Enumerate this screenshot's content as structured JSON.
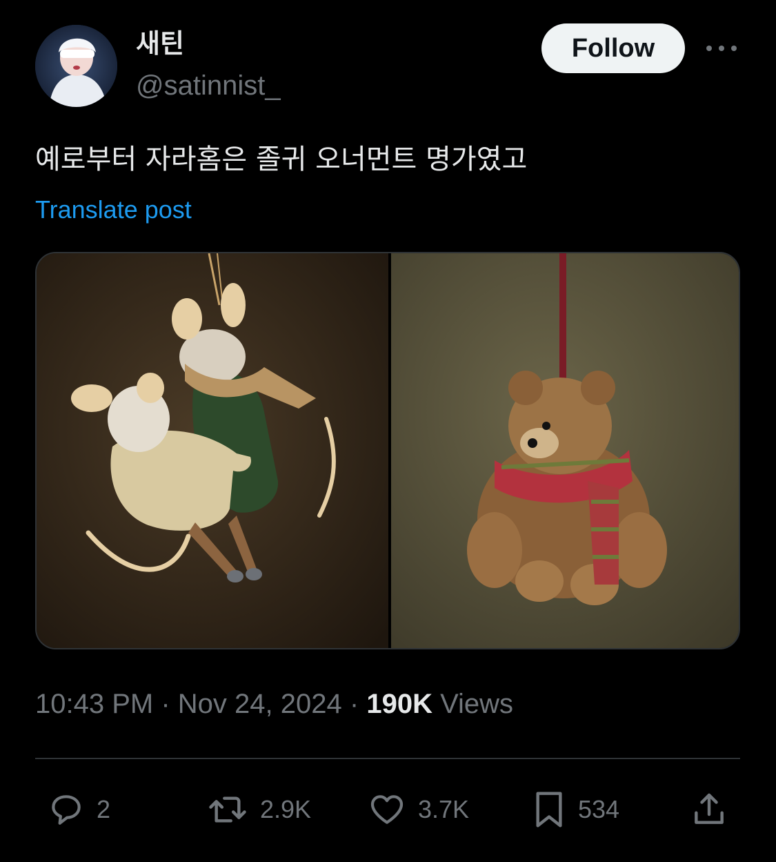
{
  "author": {
    "display_name": "새틴",
    "handle": "@satinnist_"
  },
  "header": {
    "follow_label": "Follow",
    "more_icon": "more-horizontal-icon"
  },
  "post": {
    "text": "예로부터 자라홈은 졸귀 오너먼트 명가였고",
    "translate_label": "Translate post",
    "images": [
      {
        "icon": "photo-mouse-ornament"
      },
      {
        "icon": "photo-bear-ornament"
      }
    ]
  },
  "meta": {
    "time": "10:43 PM",
    "separator": "·",
    "date": "Nov 24, 2024",
    "views_count": "190K",
    "views_label": "Views"
  },
  "actions": {
    "replies": "2",
    "reposts": "2.9K",
    "likes": "3.7K",
    "bookmarks": "534"
  },
  "colors": {
    "background": "#000000",
    "text_primary": "#e7e9ea",
    "text_secondary": "#71767b",
    "link": "#1d9bf0",
    "divider": "#2f3336",
    "follow_button_bg": "#eff3f4"
  }
}
